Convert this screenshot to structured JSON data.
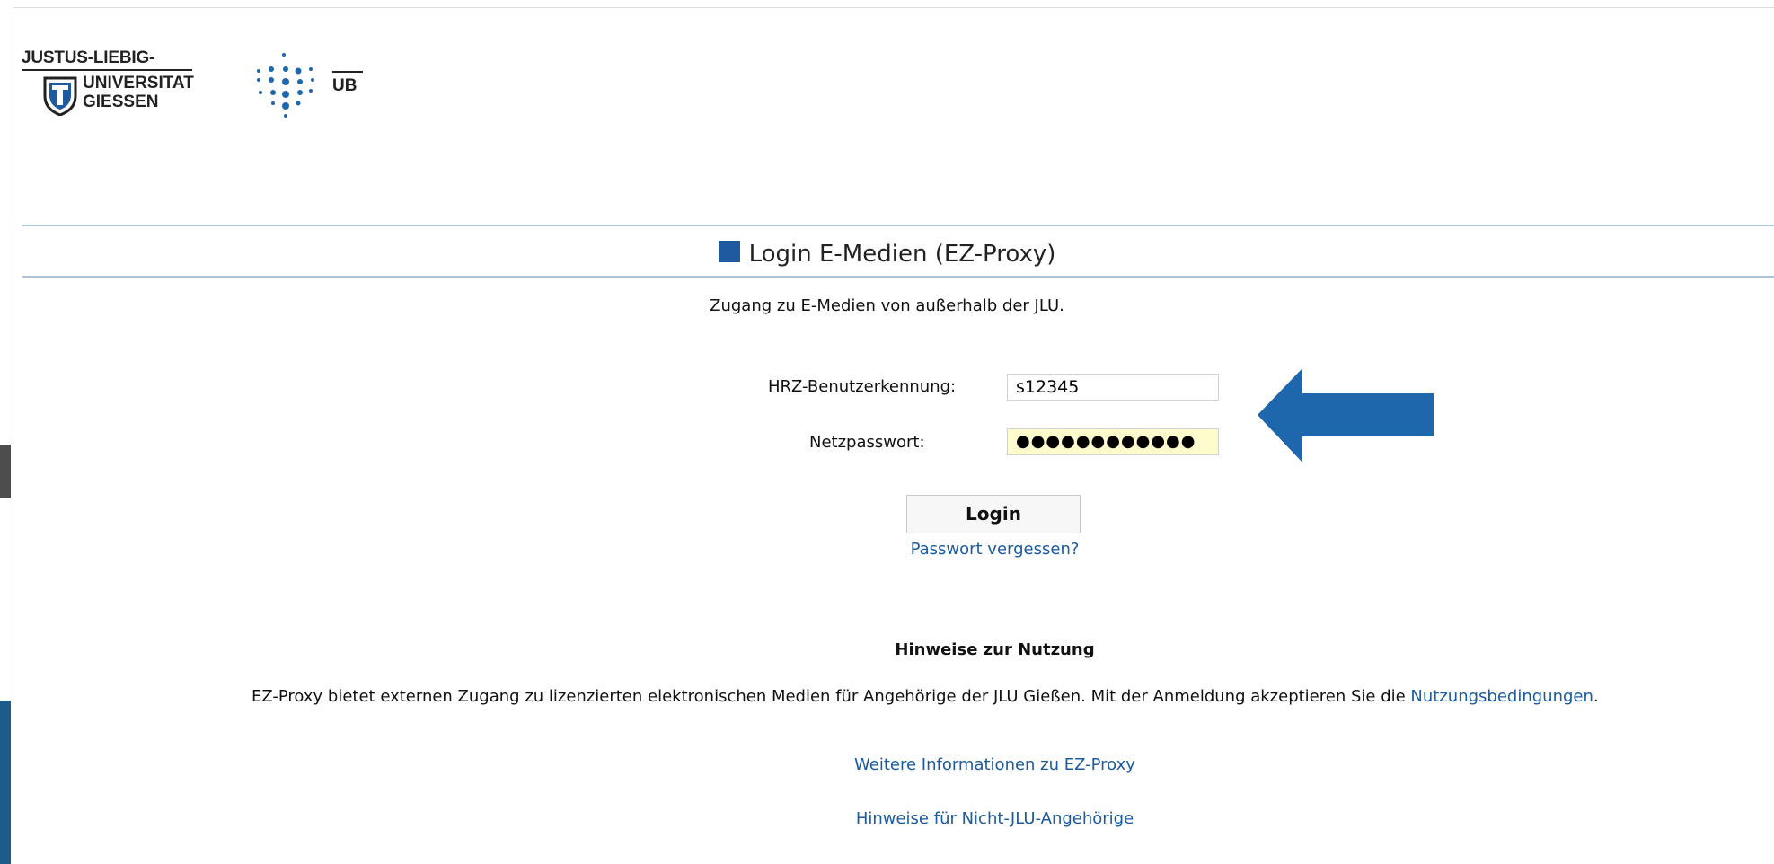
{
  "logo": {
    "line1": "JUSTUS-LIEBIG-",
    "line2": "UNIVERSITAT",
    "line3": "GIESSEN",
    "ub": "UB"
  },
  "header": {
    "title": "Login E-Medien (EZ-Proxy)",
    "subtitle": "Zugang zu E-Medien von außerhalb der JLU."
  },
  "form": {
    "username_label": "HRZ-Benutzerkennung:",
    "username_value": "s12345",
    "password_label": "Netzpasswort:",
    "password_mask": "●●●●●●●●●●●●",
    "login_label": "Login",
    "forgot_label": "Passwort vergessen?"
  },
  "hints": {
    "heading": "Hinweise zur Nutzung",
    "text": "EZ-Proxy bietet externen Zugang zu lizenzierten elektronischen Medien für Angehörige der JLU Gießen. Mit der Anmeldung akzeptieren Sie die ",
    "terms_link": "Nutzungsbedingungen",
    "terms_suffix": ".",
    "more_info_link": "Weitere Informationen zu EZ-Proxy",
    "non_jlu_link": "Hinweise für Nicht-JLU-Angehörige"
  },
  "colors": {
    "accent": "#1f5aa0",
    "link": "#1a5aa0",
    "arrow": "#1f67ad",
    "password_bg": "#fefbcd"
  }
}
